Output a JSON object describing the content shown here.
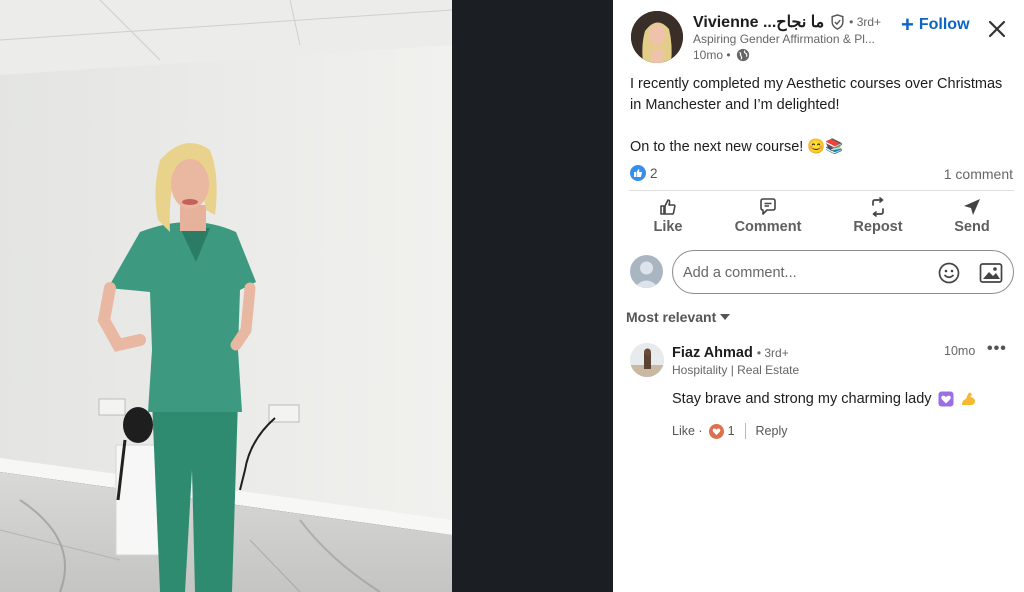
{
  "author": {
    "name": "Vivienne ...ما نجاح",
    "degree": "• 3rd+",
    "headline": "Aspiring Gender Affirmation & Pl...",
    "time": "10mo •"
  },
  "follow_label": "Follow",
  "post": {
    "line1": "I recently completed my Aesthetic courses over Christmas",
    "line2": "in Manchester and I’m delighted!",
    "line3": "On to the next new course! 😊📚"
  },
  "stats": {
    "reactions": "2",
    "comments": "1 comment"
  },
  "actions": {
    "like": "Like",
    "comment": "Comment",
    "repost": "Repost",
    "send": "Send"
  },
  "comment_input": {
    "placeholder": "Add a comment..."
  },
  "sort_label": "Most relevant",
  "comment": {
    "name": "Fiaz Ahmad",
    "degree": "• 3rd+",
    "headline": "Hospitality | Real Estate",
    "time": "10mo",
    "text": "Stay brave and strong my charming lady",
    "like_label": "Like ·",
    "like_count": "1",
    "reply_label": "Reply"
  },
  "colors": {
    "accent": "#0a66c2",
    "like_blue": "#378fe9",
    "heart": "#df704d",
    "scrubs": "#3d9a80"
  }
}
